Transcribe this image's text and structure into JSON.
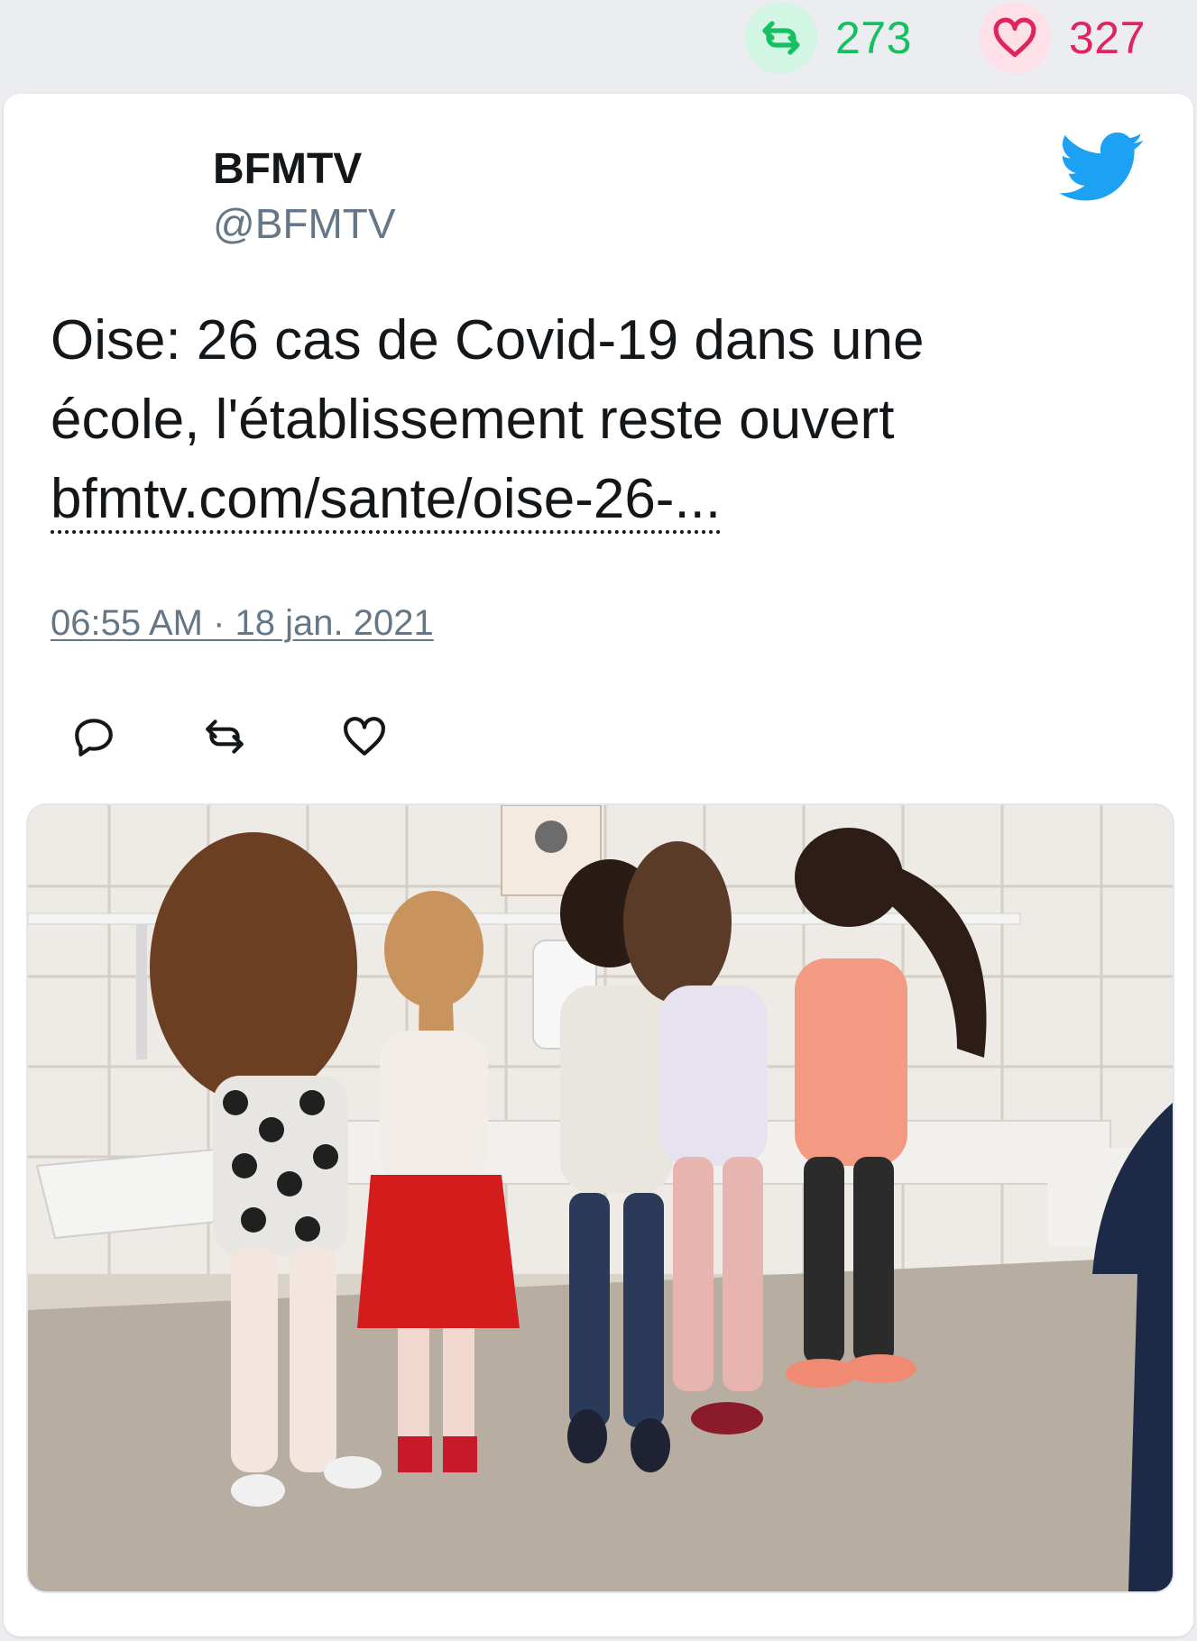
{
  "stats": {
    "retweets": "273",
    "likes": "327",
    "retweet_icon": "retweet-icon",
    "like_icon": "heart-icon"
  },
  "tweet": {
    "display_name": "BFMTV",
    "handle": "@BFMTV",
    "text_line1": "Oise: 26 cas de Covid-19 dans une",
    "text_line2": "école, l'établissement reste ouvert",
    "link_text": "bfmtv.com/sante/oise-26-...",
    "timestamp": "06:55 AM · 18 jan. 2021",
    "logo_icon": "twitter-bird-icon"
  },
  "actions": [
    {
      "icon": "reply-icon"
    },
    {
      "icon": "retweet-icon"
    },
    {
      "icon": "heart-icon"
    }
  ],
  "media": {
    "image_subject": "children washing hands at school sinks"
  },
  "colors": {
    "retweet_green": "#17bf63",
    "like_red": "#e0245e",
    "twitter_blue": "#1da1f2",
    "muted_text": "#657786"
  }
}
